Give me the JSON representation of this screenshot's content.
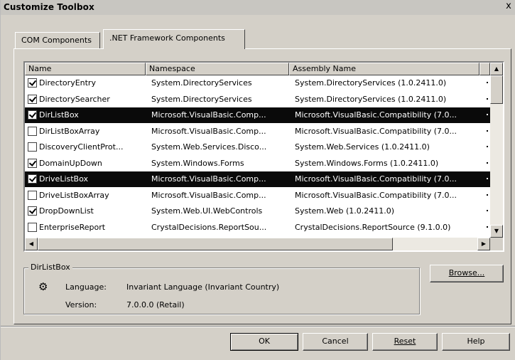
{
  "window": {
    "title": "Customize Toolbox",
    "close_glyph": "x"
  },
  "tabs": [
    {
      "label": "COM Components",
      "active": false
    },
    {
      "label": ".NET Framework Components",
      "active": true
    }
  ],
  "list": {
    "columns": [
      "Name",
      "Namespace",
      "Assembly Name"
    ],
    "rows": [
      {
        "checked": true,
        "selected": false,
        "name": "DirectoryEntry",
        "namespace": "System.DirectoryServices",
        "assembly": "System.DirectoryServices (1.0.2411.0)"
      },
      {
        "checked": true,
        "selected": false,
        "name": "DirectorySearcher",
        "namespace": "System.DirectoryServices",
        "assembly": "System.DirectoryServices (1.0.2411.0)"
      },
      {
        "checked": true,
        "selected": true,
        "name": "DirListBox",
        "namespace": "Microsoft.VisualBasic.Comp...",
        "assembly": "Microsoft.VisualBasic.Compatibility (7.0..."
      },
      {
        "checked": false,
        "selected": false,
        "name": "DirListBoxArray",
        "namespace": "Microsoft.VisualBasic.Comp...",
        "assembly": "Microsoft.VisualBasic.Compatibility (7.0..."
      },
      {
        "checked": false,
        "selected": false,
        "name": "DiscoveryClientProt...",
        "namespace": "System.Web.Services.Disco...",
        "assembly": "System.Web.Services (1.0.2411.0)"
      },
      {
        "checked": true,
        "selected": false,
        "name": "DomainUpDown",
        "namespace": "System.Windows.Forms",
        "assembly": "System.Windows.Forms (1.0.2411.0)"
      },
      {
        "checked": true,
        "selected": true,
        "name": "DriveListBox",
        "namespace": "Microsoft.VisualBasic.Comp...",
        "assembly": "Microsoft.VisualBasic.Compatibility (7.0..."
      },
      {
        "checked": false,
        "selected": false,
        "name": "DriveListBoxArray",
        "namespace": "Microsoft.VisualBasic.Comp...",
        "assembly": "Microsoft.VisualBasic.Compatibility (7.0..."
      },
      {
        "checked": true,
        "selected": false,
        "name": "DropDownList",
        "namespace": "System.Web.UI.WebControls",
        "assembly": "System.Web (1.0.2411.0)"
      },
      {
        "checked": false,
        "selected": false,
        "name": "EnterpriseReport",
        "namespace": "CrystalDecisions.ReportSou...",
        "assembly": "CrystalDecisions.ReportSource (9.1.0.0)"
      }
    ]
  },
  "details": {
    "group_label": "DirListBox",
    "icon": "component-icon",
    "language_label": "Language:",
    "language_value": "Invariant Language (Invariant Country)",
    "version_label": "Version:",
    "version_value": "7.0.0.0 (Retail)"
  },
  "buttons": {
    "browse": "Browse...",
    "ok": "OK",
    "cancel": "Cancel",
    "reset": "Reset",
    "help": "Help"
  }
}
